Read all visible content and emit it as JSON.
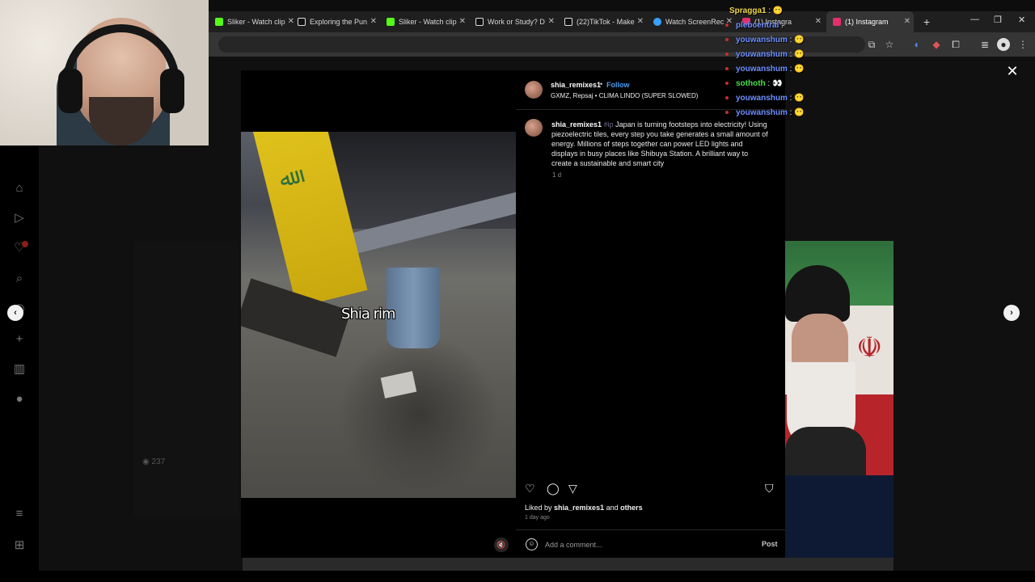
{
  "browser": {
    "tabs": [
      {
        "label": "Sliker - Watch clip",
        "icon": "kick-logo-icon",
        "color": "#53fc18"
      },
      {
        "label": "Exploring the Pun",
        "icon": "tiktok-logo-icon",
        "color": "#ffffff"
      },
      {
        "label": "Sliker - Watch clip",
        "icon": "kick-logo-icon",
        "color": "#53fc18"
      },
      {
        "label": "Work or Study? D",
        "icon": "tiktok-logo-icon",
        "color": "#ffffff"
      },
      {
        "label": "(22)TikTok - Make",
        "icon": "tiktok-logo-icon",
        "color": "#ffffff"
      },
      {
        "label": "Watch ScreenRec",
        "icon": "screenrec-logo-icon",
        "color": "#3aa0ff"
      },
      {
        "label": "(1) Instagra",
        "icon": "instagram-logo-icon",
        "color": "#e1306c"
      },
      {
        "label": "(1) Instagram",
        "icon": "instagram-logo-icon",
        "color": "#e1306c"
      }
    ],
    "new_tab": "+",
    "window_controls": {
      "minimize": "—",
      "restore": "❐",
      "close": "✕"
    }
  },
  "chat": [
    {
      "user": "Spragga1",
      "color": "#f0d84a",
      "msg": "😶"
    },
    {
      "user": "plebcentral",
      "color": "#6f8fff",
      "msg": ""
    },
    {
      "user": "youwanshum",
      "color": "#6f8fff",
      "msg": "😶"
    },
    {
      "user": "youwanshum",
      "color": "#6f8fff",
      "msg": "😶"
    },
    {
      "user": "youwanshum",
      "color": "#6f8fff",
      "msg": "😶"
    },
    {
      "user": "sothoth",
      "color": "#4ade4a",
      "msg": "👀"
    },
    {
      "user": "youwanshum",
      "color": "#6f8fff",
      "msg": "😶"
    },
    {
      "user": "youwanshum",
      "color": "#6f8fff",
      "msg": "😶"
    }
  ],
  "sidebar": {
    "items": [
      {
        "icon": "home-icon",
        "glyph": "⌂"
      },
      {
        "icon": "reels-icon",
        "glyph": "▷"
      },
      {
        "icon": "notifications-icon",
        "glyph": "♡"
      },
      {
        "icon": "search-icon",
        "glyph": "⌕"
      },
      {
        "icon": "explore-icon",
        "glyph": "◎"
      },
      {
        "icon": "create-icon",
        "glyph": "+"
      },
      {
        "icon": "insights-icon",
        "glyph": "▥"
      },
      {
        "icon": "profile-icon",
        "glyph": "●"
      }
    ],
    "menu_glyph": "≡",
    "more_glyph": "⊞"
  },
  "background": {
    "views": "237"
  },
  "post": {
    "author": "shia_remixes1",
    "dot": "•",
    "follow_label": "Follow",
    "audio": "GXMZ, Repsaj • CLIMA LINDO (SUPER SLOWED)",
    "caption_user": "shia_remixes1",
    "caption_tag": "#ip",
    "caption_body": "Japan is turning footsteps into electricity! Using piezoelectric tiles, every step you take generates a small amount of energy. Millions of steps together can power LED lights and displays in busy places like Shibuya Station. A brilliant way to create a sustainable and smart city",
    "caption_time": "1 d",
    "video_caption": "Shia rim",
    "liked_prefix": "Liked by ",
    "liked_user": "shia_remixes1",
    "liked_and": " and ",
    "liked_others": "others",
    "posted": "1 day ago",
    "comment_placeholder": "Add a comment...",
    "post_label": "Post"
  },
  "icons": {
    "close": "✕",
    "prev": "‹",
    "next": "›",
    "mute": "🔇",
    "emoji": "☺",
    "like": "♡",
    "comment": "◯",
    "share": "▽",
    "save": "⛉"
  }
}
